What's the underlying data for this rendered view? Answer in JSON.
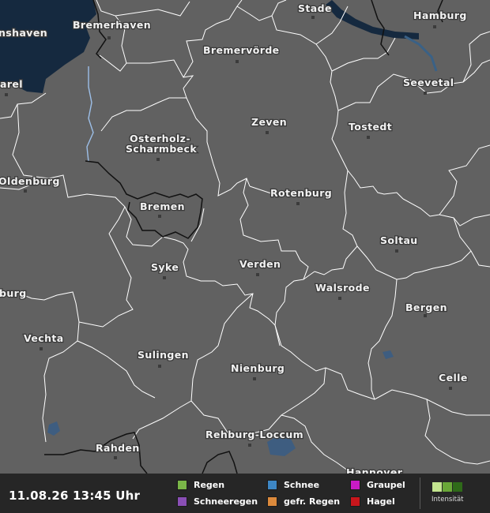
{
  "map": {
    "colors": {
      "land": "#616161",
      "water": "#15293f",
      "border": "#ffffff",
      "state_border": "#111111",
      "river": "#9dbfe8"
    },
    "cities": [
      {
        "name": "Stade"
      },
      {
        "name": "Hamburg"
      },
      {
        "name": "nshaven"
      },
      {
        "name": "Bremerhaven"
      },
      {
        "name": "Bremervörde"
      },
      {
        "name": "arel"
      },
      {
        "name": "Seevetal"
      },
      {
        "name": "Zeven"
      },
      {
        "name": "Tostedt"
      },
      {
        "name": "Osterholz-"
      },
      {
        "name": "Scharmbeck"
      },
      {
        "name": "Oldenburg"
      },
      {
        "name": "Rotenburg"
      },
      {
        "name": "Bremen"
      },
      {
        "name": "Soltau"
      },
      {
        "name": "Syke"
      },
      {
        "name": "Verden"
      },
      {
        "name": "Walsrode"
      },
      {
        "name": "burg"
      },
      {
        "name": "Bergen"
      },
      {
        "name": "Vechta"
      },
      {
        "name": "Sulingen"
      },
      {
        "name": "Nienburg"
      },
      {
        "name": "Celle"
      },
      {
        "name": "Rehburg-Loccum"
      },
      {
        "name": "Rahden"
      },
      {
        "name": "Hannover"
      }
    ]
  },
  "footer": {
    "timestamp": "11.08.26 13:45 Uhr",
    "legend": [
      {
        "label": "Regen",
        "color": "#7ab648"
      },
      {
        "label": "Schnee",
        "color": "#3d86c4"
      },
      {
        "label": "Graupel",
        "color": "#c81bc6"
      },
      {
        "label": "Schneeregen",
        "color": "#8a4fb5"
      },
      {
        "label": "gefr. Regen",
        "color": "#dc8a3c"
      },
      {
        "label": "Hagel",
        "color": "#c8161c"
      }
    ],
    "intensity": {
      "label": "Intensität",
      "colors": [
        "#c3e58f",
        "#6aa838",
        "#2f6a19"
      ]
    }
  }
}
